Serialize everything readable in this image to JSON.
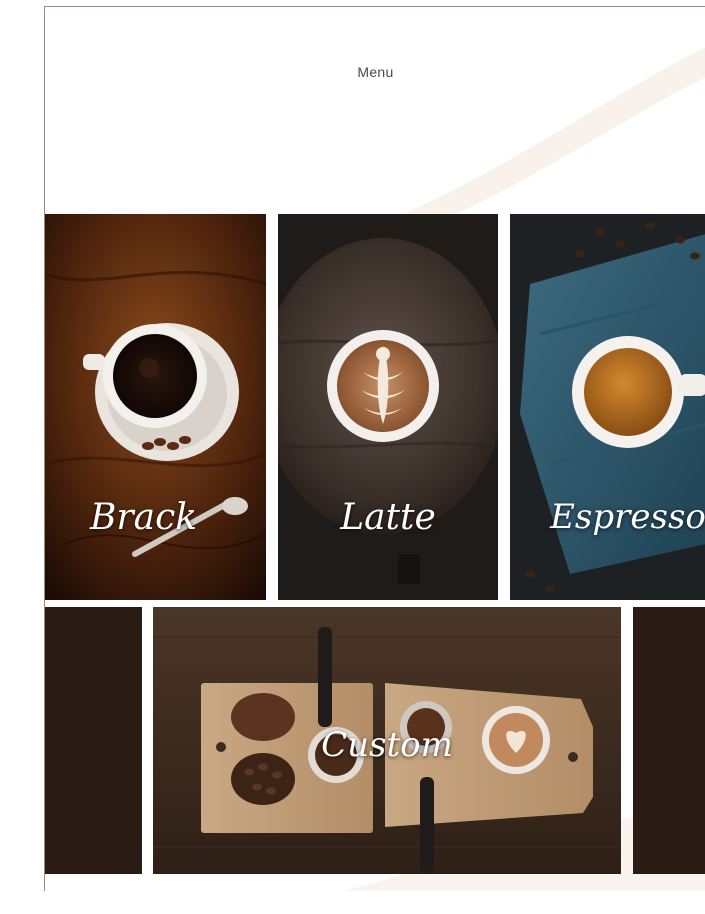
{
  "header": {
    "title": "Menu"
  },
  "menu": {
    "items": [
      {
        "label": "Brack"
      },
      {
        "label": "Latte"
      },
      {
        "label": "Espresso"
      },
      {
        "label": "Custom"
      }
    ]
  },
  "colors": {
    "background": "#ffffff",
    "panel_dark": "#2a1c15",
    "label_text": "#ffffff"
  }
}
